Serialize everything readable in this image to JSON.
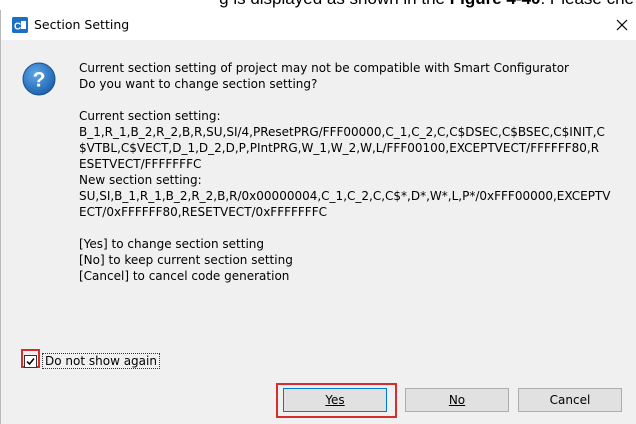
{
  "document_fragment": {
    "prefix": "g is displayed as shown in the ",
    "figure": "Figure 4-40",
    "suffix": ". Please che"
  },
  "window": {
    "title": "Section Setting",
    "close_glyph": "×"
  },
  "message": {
    "line1": "Current section setting of project may not be compatible with Smart Configurator",
    "line2": "Do you want to change section setting?",
    "current_heading": "Current section setting:",
    "current_lines": [
      "B_1,R_1,B_2,R_2,B,R,SU,SI/4,PResetPRG/FFF00000,C_1,C_2,C,C$DSEC,C$BSEC,C$INIT,C",
      "$VTBL,C$VECT,D_1,D_2,D,P,PIntPRG,W_1,W_2,W,L/FFF00100,EXCEPTVECT/FFFFFF80,R",
      "ESETVECT/FFFFFFFC"
    ],
    "new_heading": "New section setting:",
    "new_lines": [
      "SU,SI,B_1,R_1,B_2,R_2,B,R/0x00000004,C_1,C_2,C,C$*,D*,W*,L,P*/0xFFF00000,EXCEPTV",
      "ECT/0xFFFFFF80,RESETVECT/0xFFFFFFFC"
    ],
    "option_yes": "[Yes] to change section setting",
    "option_no": "[No] to keep current section setting",
    "option_cancel": "[Cancel] to cancel code generation"
  },
  "checkbox": {
    "label": "Do not show again",
    "checked": true
  },
  "buttons": {
    "yes": "Yes",
    "no": "No",
    "cancel": "Cancel"
  },
  "colors": {
    "highlight": "#d32f2f",
    "dialog_bg": "#f0f0f0",
    "default_button_border": "#0078d7",
    "icon_blue": "#1d6fc4"
  },
  "icons": {
    "app": "smart-configurator-icon",
    "question": "question-icon",
    "close": "close-icon",
    "check": "check-icon"
  }
}
